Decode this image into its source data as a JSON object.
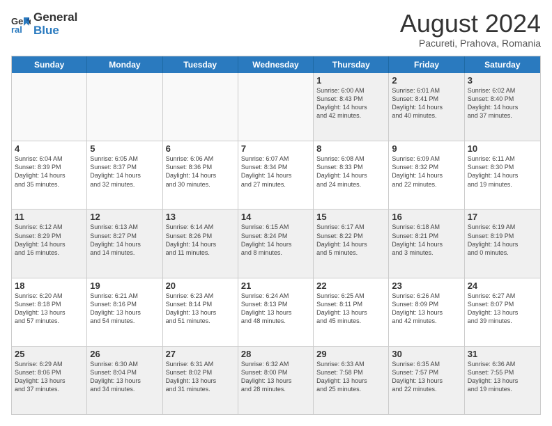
{
  "logo": {
    "line1": "General",
    "line2": "Blue"
  },
  "title": "August 2024",
  "subtitle": "Pacureti, Prahova, Romania",
  "days": [
    "Sunday",
    "Monday",
    "Tuesday",
    "Wednesday",
    "Thursday",
    "Friday",
    "Saturday"
  ],
  "weeks": [
    [
      {
        "day": "",
        "info": "",
        "empty": true
      },
      {
        "day": "",
        "info": "",
        "empty": true
      },
      {
        "day": "",
        "info": "",
        "empty": true
      },
      {
        "day": "",
        "info": "",
        "empty": true
      },
      {
        "day": "1",
        "info": "Sunrise: 6:00 AM\nSunset: 8:43 PM\nDaylight: 14 hours\nand 42 minutes."
      },
      {
        "day": "2",
        "info": "Sunrise: 6:01 AM\nSunset: 8:41 PM\nDaylight: 14 hours\nand 40 minutes."
      },
      {
        "day": "3",
        "info": "Sunrise: 6:02 AM\nSunset: 8:40 PM\nDaylight: 14 hours\nand 37 minutes."
      }
    ],
    [
      {
        "day": "4",
        "info": "Sunrise: 6:04 AM\nSunset: 8:39 PM\nDaylight: 14 hours\nand 35 minutes."
      },
      {
        "day": "5",
        "info": "Sunrise: 6:05 AM\nSunset: 8:37 PM\nDaylight: 14 hours\nand 32 minutes."
      },
      {
        "day": "6",
        "info": "Sunrise: 6:06 AM\nSunset: 8:36 PM\nDaylight: 14 hours\nand 30 minutes."
      },
      {
        "day": "7",
        "info": "Sunrise: 6:07 AM\nSunset: 8:34 PM\nDaylight: 14 hours\nand 27 minutes."
      },
      {
        "day": "8",
        "info": "Sunrise: 6:08 AM\nSunset: 8:33 PM\nDaylight: 14 hours\nand 24 minutes."
      },
      {
        "day": "9",
        "info": "Sunrise: 6:09 AM\nSunset: 8:32 PM\nDaylight: 14 hours\nand 22 minutes."
      },
      {
        "day": "10",
        "info": "Sunrise: 6:11 AM\nSunset: 8:30 PM\nDaylight: 14 hours\nand 19 minutes."
      }
    ],
    [
      {
        "day": "11",
        "info": "Sunrise: 6:12 AM\nSunset: 8:29 PM\nDaylight: 14 hours\nand 16 minutes."
      },
      {
        "day": "12",
        "info": "Sunrise: 6:13 AM\nSunset: 8:27 PM\nDaylight: 14 hours\nand 14 minutes."
      },
      {
        "day": "13",
        "info": "Sunrise: 6:14 AM\nSunset: 8:26 PM\nDaylight: 14 hours\nand 11 minutes."
      },
      {
        "day": "14",
        "info": "Sunrise: 6:15 AM\nSunset: 8:24 PM\nDaylight: 14 hours\nand 8 minutes."
      },
      {
        "day": "15",
        "info": "Sunrise: 6:17 AM\nSunset: 8:22 PM\nDaylight: 14 hours\nand 5 minutes."
      },
      {
        "day": "16",
        "info": "Sunrise: 6:18 AM\nSunset: 8:21 PM\nDaylight: 14 hours\nand 3 minutes."
      },
      {
        "day": "17",
        "info": "Sunrise: 6:19 AM\nSunset: 8:19 PM\nDaylight: 14 hours\nand 0 minutes."
      }
    ],
    [
      {
        "day": "18",
        "info": "Sunrise: 6:20 AM\nSunset: 8:18 PM\nDaylight: 13 hours\nand 57 minutes."
      },
      {
        "day": "19",
        "info": "Sunrise: 6:21 AM\nSunset: 8:16 PM\nDaylight: 13 hours\nand 54 minutes."
      },
      {
        "day": "20",
        "info": "Sunrise: 6:23 AM\nSunset: 8:14 PM\nDaylight: 13 hours\nand 51 minutes."
      },
      {
        "day": "21",
        "info": "Sunrise: 6:24 AM\nSunset: 8:13 PM\nDaylight: 13 hours\nand 48 minutes."
      },
      {
        "day": "22",
        "info": "Sunrise: 6:25 AM\nSunset: 8:11 PM\nDaylight: 13 hours\nand 45 minutes."
      },
      {
        "day": "23",
        "info": "Sunrise: 6:26 AM\nSunset: 8:09 PM\nDaylight: 13 hours\nand 42 minutes."
      },
      {
        "day": "24",
        "info": "Sunrise: 6:27 AM\nSunset: 8:07 PM\nDaylight: 13 hours\nand 39 minutes."
      }
    ],
    [
      {
        "day": "25",
        "info": "Sunrise: 6:29 AM\nSunset: 8:06 PM\nDaylight: 13 hours\nand 37 minutes."
      },
      {
        "day": "26",
        "info": "Sunrise: 6:30 AM\nSunset: 8:04 PM\nDaylight: 13 hours\nand 34 minutes."
      },
      {
        "day": "27",
        "info": "Sunrise: 6:31 AM\nSunset: 8:02 PM\nDaylight: 13 hours\nand 31 minutes."
      },
      {
        "day": "28",
        "info": "Sunrise: 6:32 AM\nSunset: 8:00 PM\nDaylight: 13 hours\nand 28 minutes."
      },
      {
        "day": "29",
        "info": "Sunrise: 6:33 AM\nSunset: 7:58 PM\nDaylight: 13 hours\nand 25 minutes."
      },
      {
        "day": "30",
        "info": "Sunrise: 6:35 AM\nSunset: 7:57 PM\nDaylight: 13 hours\nand 22 minutes."
      },
      {
        "day": "31",
        "info": "Sunrise: 6:36 AM\nSunset: 7:55 PM\nDaylight: 13 hours\nand 19 minutes."
      }
    ]
  ]
}
